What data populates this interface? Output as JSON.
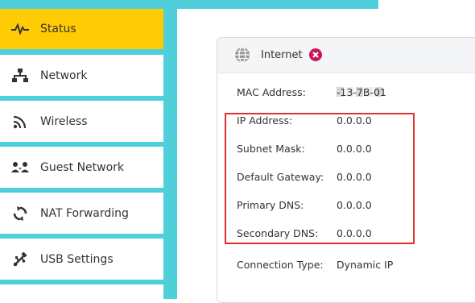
{
  "sidebar": {
    "items": [
      {
        "label": "Status",
        "icon": "pulse-icon",
        "active": true
      },
      {
        "label": "Network",
        "icon": "network-icon",
        "active": false
      },
      {
        "label": "Wireless",
        "icon": "wifi-icon",
        "active": false
      },
      {
        "label": "Guest Network",
        "icon": "guests-icon",
        "active": false
      },
      {
        "label": "NAT Forwarding",
        "icon": "refresh-icon",
        "active": false
      },
      {
        "label": "USB Settings",
        "icon": "usb-icon",
        "active": false
      }
    ]
  },
  "internet_panel": {
    "title": "Internet",
    "status": "disconnected",
    "mac": {
      "label": "MAC Address:",
      "value_visible": "-13-7B-01"
    },
    "ip": {
      "label": "IP Address:",
      "value": "0.0.0.0"
    },
    "subnet": {
      "label": "Subnet Mask:",
      "value": "0.0.0.0"
    },
    "gateway": {
      "label": "Default Gateway:",
      "value": "0.0.0.0"
    },
    "primary_dns": {
      "label": "Primary DNS:",
      "value": "0.0.0.0"
    },
    "secondary_dns": {
      "label": "Secondary DNS:",
      "value": "0.0.0.0"
    },
    "connection_type": {
      "label": "Connection Type:",
      "value": "Dynamic IP"
    }
  },
  "colors": {
    "frame": "#4fcfd9",
    "active": "#ffcb05",
    "error": "#c6195b",
    "highlight": "#e0302f"
  }
}
